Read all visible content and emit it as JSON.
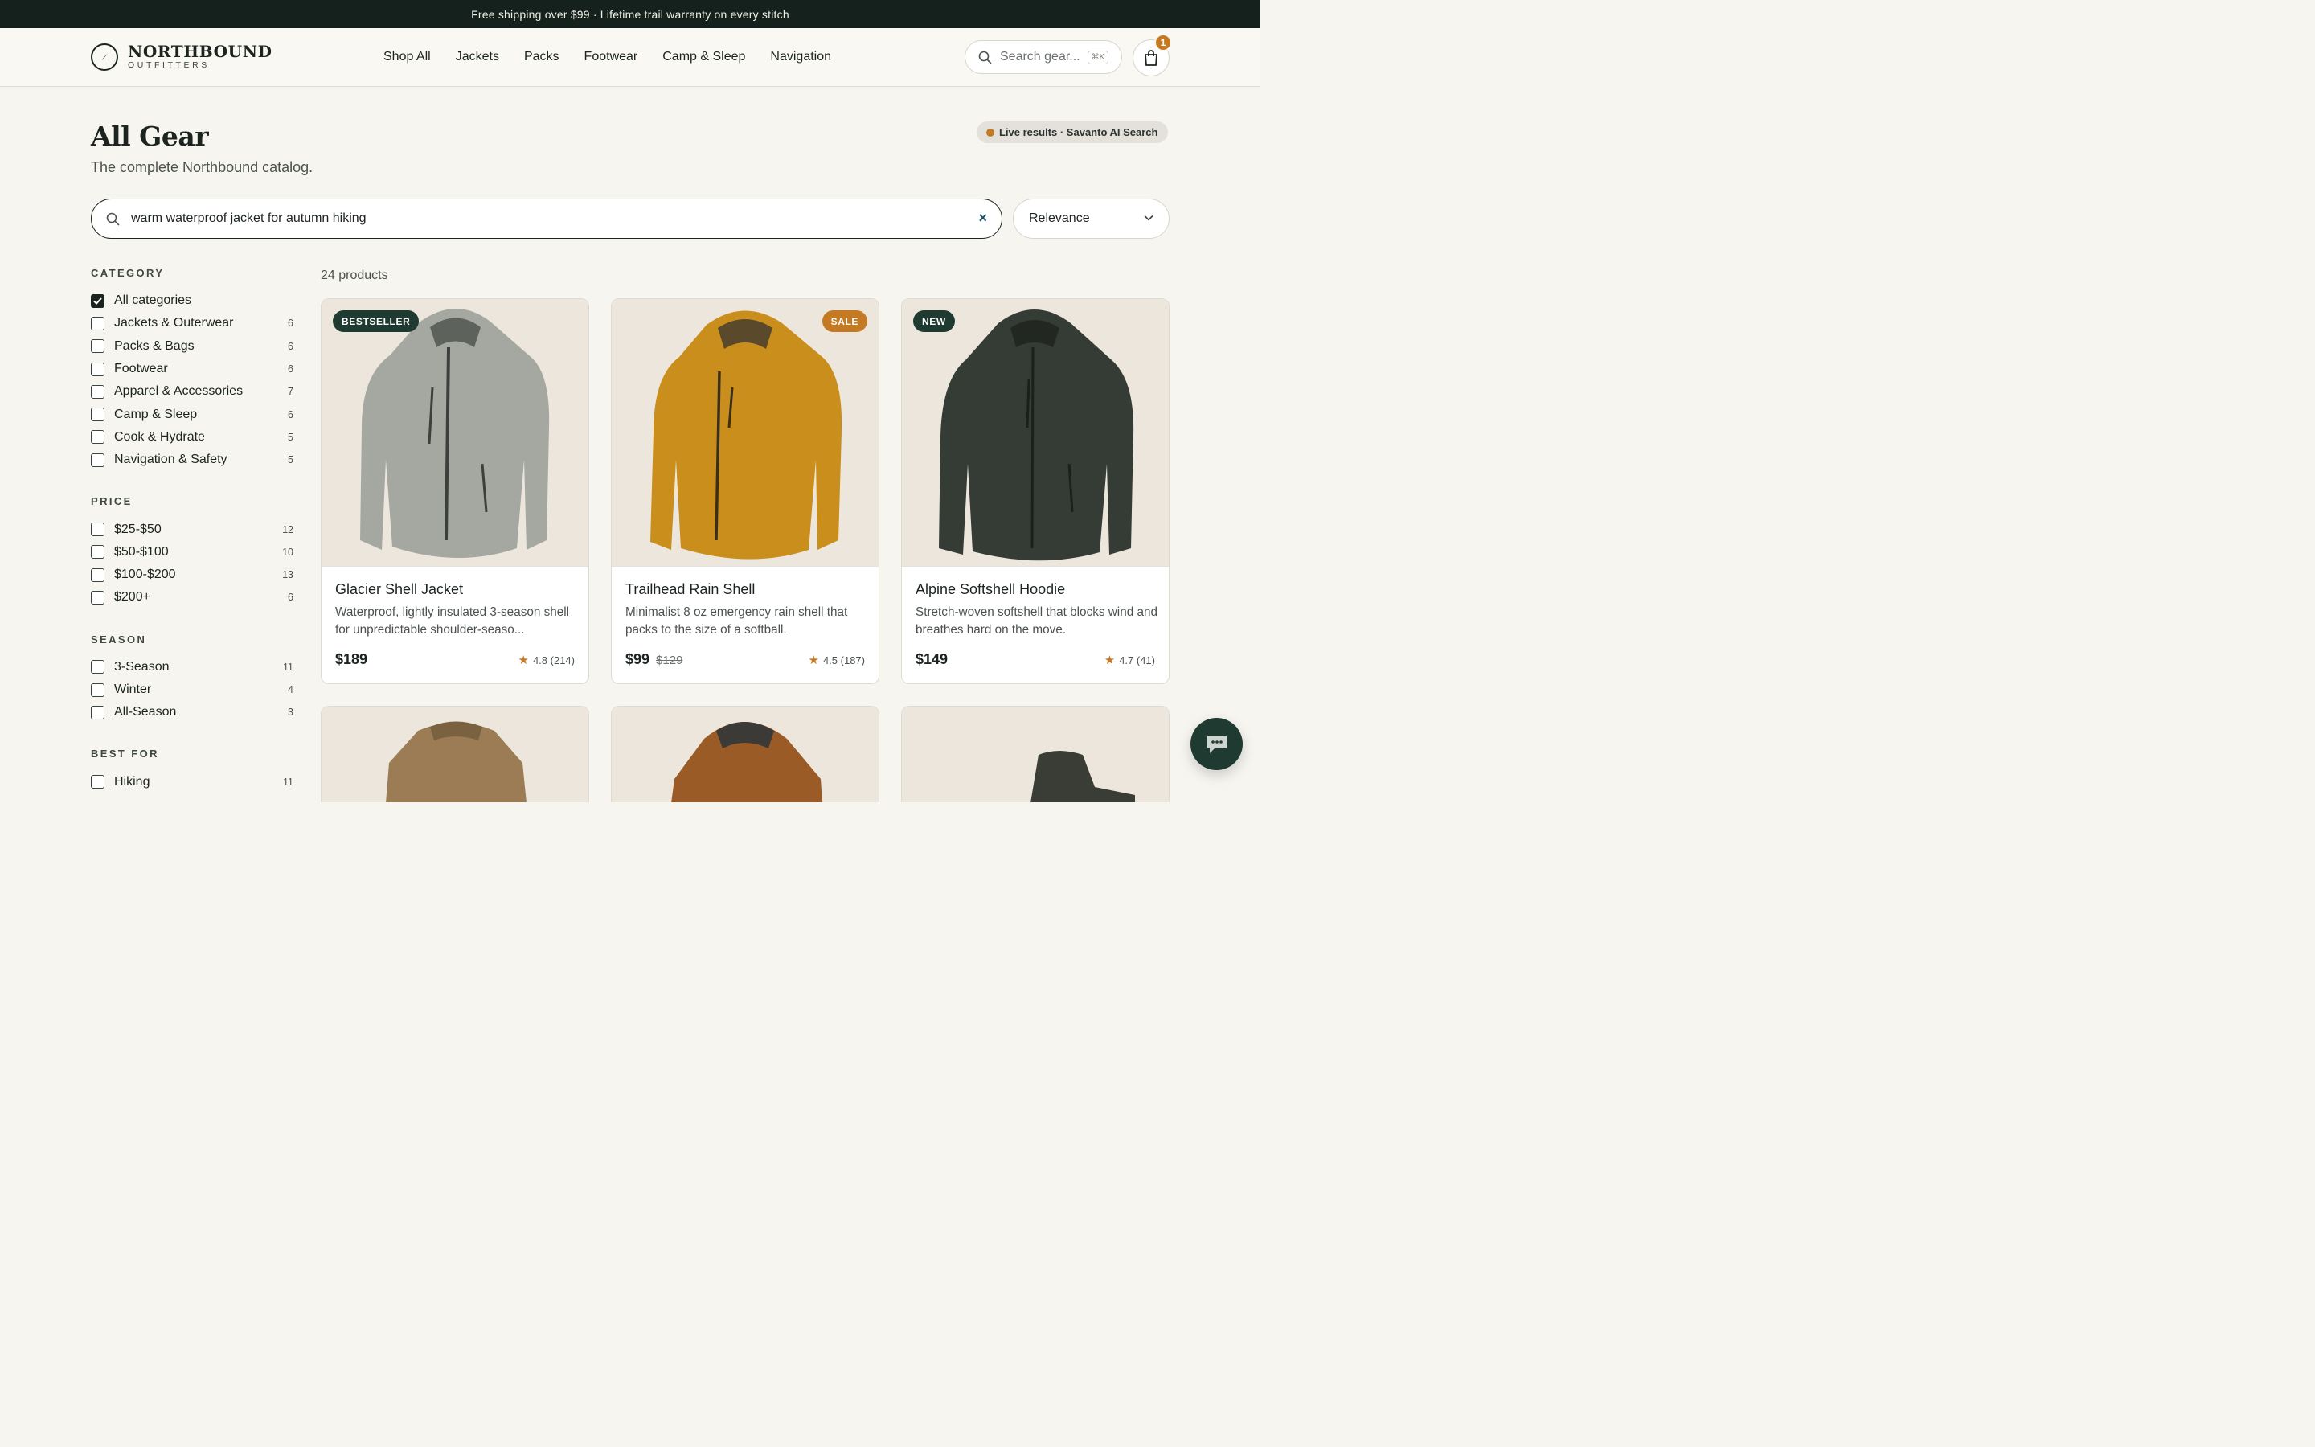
{
  "announcement": "Free shipping over $99 · Lifetime trail warranty on every stitch",
  "brand": {
    "name": "NORTHBOUND",
    "sub": "OUTFITTERS"
  },
  "nav": [
    "Shop All",
    "Jackets",
    "Packs",
    "Footwear",
    "Camp & Sleep",
    "Navigation"
  ],
  "header_search": {
    "placeholder": "Search gear...",
    "shortcut": "⌘K"
  },
  "cart": {
    "count": "1"
  },
  "page": {
    "title": "All Gear",
    "subtitle": "The complete Northbound catalog.",
    "live_badge": "Live results · Savanto AI Search"
  },
  "query": {
    "value": "warm waterproof jacket for autumn hiking",
    "clear": "×"
  },
  "sort": {
    "selected": "Relevance"
  },
  "results": {
    "count_label": "24 products"
  },
  "facets": {
    "category": {
      "title": "CATEGORY",
      "options": [
        {
          "label": "All categories",
          "count": "",
          "checked": true
        },
        {
          "label": "Jackets & Outerwear",
          "count": "6"
        },
        {
          "label": "Packs & Bags",
          "count": "6"
        },
        {
          "label": "Footwear",
          "count": "6"
        },
        {
          "label": "Apparel & Accessories",
          "count": "7"
        },
        {
          "label": "Camp & Sleep",
          "count": "6"
        },
        {
          "label": "Cook & Hydrate",
          "count": "5"
        },
        {
          "label": "Navigation & Safety",
          "count": "5"
        }
      ]
    },
    "price": {
      "title": "PRICE",
      "options": [
        {
          "label": "$25-$50",
          "count": "12"
        },
        {
          "label": "$50-$100",
          "count": "10"
        },
        {
          "label": "$100-$200",
          "count": "13"
        },
        {
          "label": "$200+",
          "count": "6"
        }
      ]
    },
    "season": {
      "title": "SEASON",
      "options": [
        {
          "label": "3-Season",
          "count": "11"
        },
        {
          "label": "Winter",
          "count": "4"
        },
        {
          "label": "All-Season",
          "count": "3"
        }
      ]
    },
    "best_for": {
      "title": "BEST FOR",
      "options": [
        {
          "label": "Hiking",
          "count": "11"
        }
      ]
    }
  },
  "products": [
    {
      "tag": "BESTSELLER",
      "tag_color": "#1f3a30",
      "name": "Glacier Shell Jacket",
      "desc": "Waterproof, lightly insulated 3-season shell for unpredictable shoulder-seaso...",
      "price": "$189",
      "was": "",
      "rating": "4.8 (214)",
      "color": "#a5a8a1"
    },
    {
      "tag": "SALE",
      "tag_color": "#c47a22",
      "name": "Trailhead Rain Shell",
      "desc": "Minimalist 8 oz emergency rain shell that packs to the size of a softball.",
      "price": "$99",
      "was": "$129",
      "rating": "4.5 (187)",
      "color": "#c98e1c"
    },
    {
      "tag": "NEW",
      "tag_color": "#1f3a30",
      "name": "Alpine Softshell Hoodie",
      "desc": "Stretch-woven softshell that blocks wind and breathes hard on the move.",
      "price": "$149",
      "was": "",
      "rating": "4.7 (41)",
      "color": "#353b35"
    }
  ],
  "colors": {
    "accent": "#c47a22",
    "dark": "#1f3a30",
    "bg": "#f7f5f0"
  }
}
